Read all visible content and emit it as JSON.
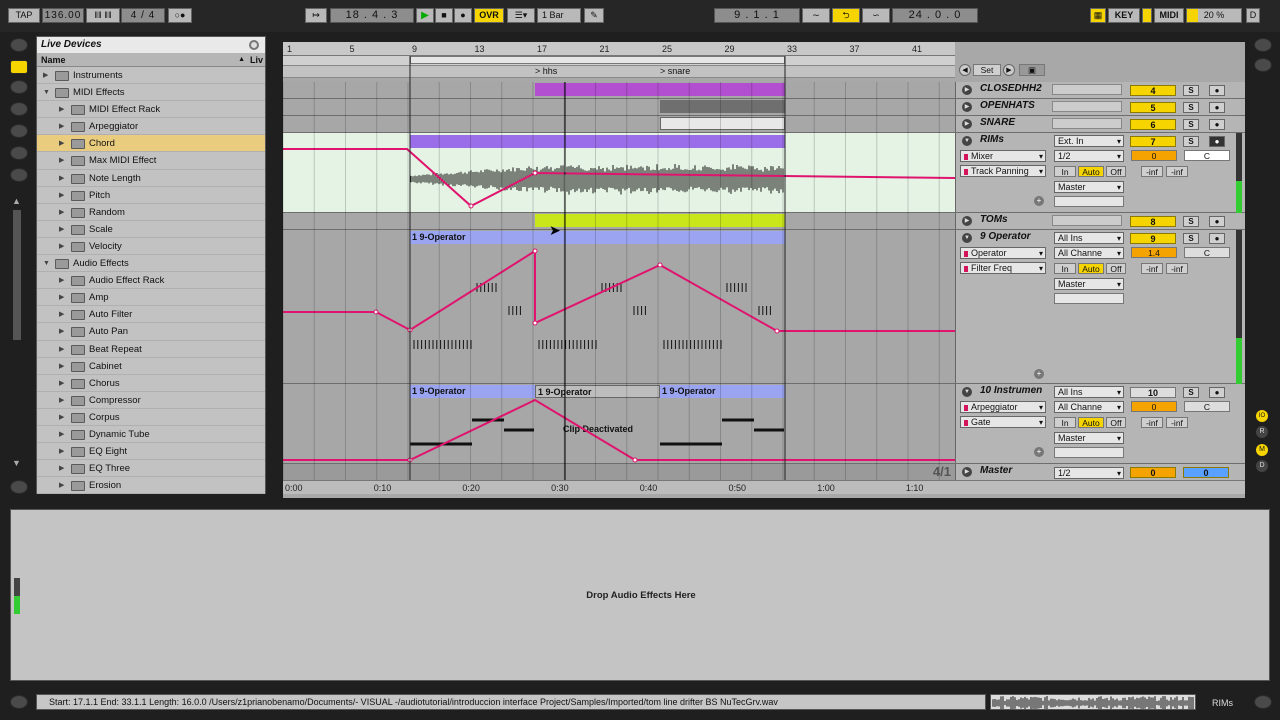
{
  "toolbar": {
    "tap": "TAP",
    "tempo": "136.00",
    "time_sig": "4 / 4",
    "position": "18 .  4 .  3",
    "ovr": "OVR",
    "quantize": "1 Bar",
    "loop_start": "9 .  1 .  1",
    "loop_length": "24 .  0 .  0",
    "key": "KEY",
    "midi": "MIDI",
    "cpu": "20 %",
    "d": "D"
  },
  "browser": {
    "title": "Live Devices",
    "col_name": "Name",
    "col_live": "Liv",
    "items": [
      {
        "label": "Instruments",
        "level": 0,
        "tri": "▶"
      },
      {
        "label": "MIDI Effects",
        "level": 0,
        "tri": "▼"
      },
      {
        "label": "MIDI Effect Rack",
        "level": 1,
        "tri": "▶"
      },
      {
        "label": "Arpeggiator",
        "level": 1,
        "tri": "▶"
      },
      {
        "label": "Chord",
        "level": 1,
        "tri": "▶",
        "selected": true
      },
      {
        "label": "Max MIDI Effect",
        "level": 1,
        "tri": "▶"
      },
      {
        "label": "Note Length",
        "level": 1,
        "tri": "▶"
      },
      {
        "label": "Pitch",
        "level": 1,
        "tri": "▶"
      },
      {
        "label": "Random",
        "level": 1,
        "tri": "▶"
      },
      {
        "label": "Scale",
        "level": 1,
        "tri": "▶"
      },
      {
        "label": "Velocity",
        "level": 1,
        "tri": "▶"
      },
      {
        "label": "Audio Effects",
        "level": 0,
        "tri": "▼"
      },
      {
        "label": "Audio Effect Rack",
        "level": 1,
        "tri": "▶"
      },
      {
        "label": "Amp",
        "level": 1,
        "tri": "▶"
      },
      {
        "label": "Auto Filter",
        "level": 1,
        "tri": "▶"
      },
      {
        "label": "Auto Pan",
        "level": 1,
        "tri": "▶"
      },
      {
        "label": "Beat Repeat",
        "level": 1,
        "tri": "▶"
      },
      {
        "label": "Cabinet",
        "level": 1,
        "tri": "▶"
      },
      {
        "label": "Chorus",
        "level": 1,
        "tri": "▶"
      },
      {
        "label": "Compressor",
        "level": 1,
        "tri": "▶"
      },
      {
        "label": "Corpus",
        "level": 1,
        "tri": "▶"
      },
      {
        "label": "Dynamic Tube",
        "level": 1,
        "tri": "▶"
      },
      {
        "label": "EQ Eight",
        "level": 1,
        "tri": "▶"
      },
      {
        "label": "EQ Three",
        "level": 1,
        "tri": "▶"
      },
      {
        "label": "Erosion",
        "level": 1,
        "tri": "▶"
      }
    ]
  },
  "ruler": {
    "bars": [
      "1",
      "5",
      "9",
      "13",
      "17",
      "21",
      "25",
      "29",
      "33",
      "37",
      "41"
    ],
    "set_label": "Set",
    "locators": [
      "hhs",
      "snare"
    ]
  },
  "tracks": {
    "closedhh2": {
      "name": "CLOSEDHH2",
      "number": "4"
    },
    "openhats": {
      "name": "OPENHATS",
      "number": "5"
    },
    "snare": {
      "name": "SNARE",
      "number": "6"
    },
    "rims": {
      "name": "RIMs",
      "number": "7",
      "input": "Ext. In",
      "channel": "1/2",
      "volume": "0",
      "pan": "C",
      "device_chooser": "Mixer",
      "control_chooser": "Track Panning",
      "out": "Master",
      "in": "In",
      "auto": "Auto",
      "off": "Off",
      "inf1": "-inf",
      "inf2": "-inf"
    },
    "toms": {
      "name": "TOMs",
      "number": "8"
    },
    "operator9": {
      "name": "9 Operator",
      "number": "9",
      "input": "All Ins",
      "channel": "All Channe",
      "volume": "1.4",
      "pan": "C",
      "device_chooser": "Operator",
      "control_chooser": "Filter Freq",
      "out": "Master",
      "clip": "1 9-Operator",
      "in": "In",
      "auto": "Auto",
      "off": "Off",
      "inf1": "-inf",
      "inf2": "-inf"
    },
    "instrument10": {
      "name": "10 Instrumen",
      "number": "10",
      "input": "All Ins",
      "channel": "All Channe",
      "volume": "0",
      "pan": "C",
      "device_chooser": "Arpeggiator",
      "control_chooser": "Gate",
      "out": "Master",
      "clips": [
        "1 9-Operator",
        "1 9-Operator",
        "1 9-Operator"
      ],
      "deactivated": "Clip Deactivated",
      "in": "In",
      "auto": "Auto",
      "off": "Off",
      "inf1": "-inf",
      "inf2": "-inf"
    },
    "master": {
      "name": "Master",
      "channel": "1/2",
      "volume": "0",
      "pan": "0"
    }
  },
  "grid_fraction": "4/1",
  "timeline": [
    "0:00",
    "0:10",
    "0:20",
    "0:30",
    "0:40",
    "0:50",
    "1:00",
    "1:10"
  ],
  "device_view": {
    "placeholder": "Drop Audio Effects Here"
  },
  "status_bar": {
    "text": "Start: 17.1.1  End: 33.1.1  Length: 16.0.0  /Users/z1prianobenamo/Documents/- VISUAL -/audiotutorial/introduccion  interface Project/Samples/Imported/tom line drifter  BS NuTecGrv.wav",
    "rims": "RIMs"
  },
  "colors": {
    "clip_purple": "#b24fd0",
    "clip_blue": "#9aa4f0",
    "clip_lime": "#c8e61a",
    "automation": "#e0146e",
    "yellow": "#f5d400"
  }
}
